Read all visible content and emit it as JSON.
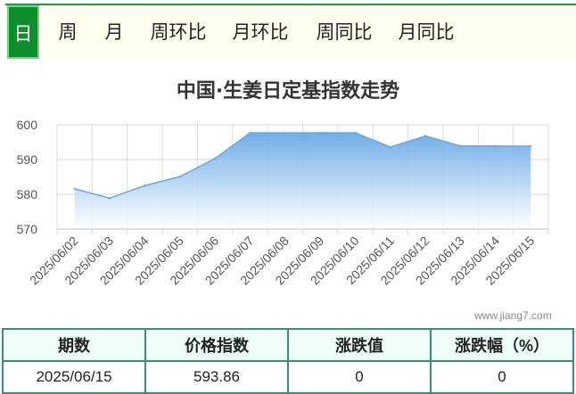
{
  "tabs": [
    {
      "label": "日",
      "active": true
    },
    {
      "label": "周",
      "active": false
    },
    {
      "label": "月",
      "active": false
    },
    {
      "label": "周环比",
      "active": false
    },
    {
      "label": "月环比",
      "active": false
    },
    {
      "label": "周同比",
      "active": false
    },
    {
      "label": "月同比",
      "active": false
    }
  ],
  "watermark": "www.jiang7.com",
  "chart_data": {
    "type": "area",
    "title": "中国·生姜日定基指数走势",
    "xlabel": "",
    "ylabel": "",
    "ylim": [
      570,
      600
    ],
    "yticks": [
      570,
      580,
      590,
      600
    ],
    "grid": true,
    "x": [
      "2025/06/02",
      "2025/06/03",
      "2025/06/04",
      "2025/06/05",
      "2025/06/06",
      "2025/06/07",
      "2025/06/08",
      "2025/06/09",
      "2025/06/10",
      "2025/06/11",
      "2025/06/12",
      "2025/06/13",
      "2025/06/14",
      "2025/06/15"
    ],
    "series": [
      {
        "values": [
          581.6,
          578.9,
          582.5,
          585.1,
          590.3,
          597.7,
          597.7,
          597.7,
          597.7,
          593.6,
          596.8,
          593.9,
          593.9,
          593.86
        ]
      }
    ],
    "colors": {
      "line": "#6aa8e6",
      "fill_top": "#6aa8e6",
      "fill_bottom": "#ffffff"
    }
  },
  "table": {
    "headers": [
      "期数",
      "价格指数",
      "涨跌值",
      "涨跌幅（%）"
    ],
    "row": [
      "2025/06/15",
      "593.86",
      "0",
      "0"
    ]
  }
}
